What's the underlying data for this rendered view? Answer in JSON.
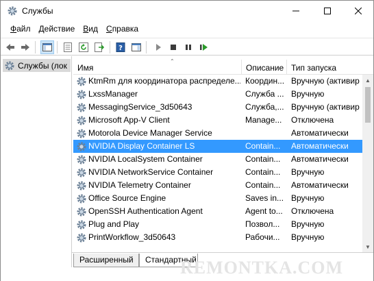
{
  "window": {
    "title": "Службы",
    "icon": "gear-icon",
    "controls": [
      "minimize-icon",
      "maximize-icon",
      "close-icon"
    ]
  },
  "menu": {
    "items": [
      {
        "underline": "Ф",
        "rest": "айл"
      },
      {
        "underline": "Д",
        "rest": "ействие"
      },
      {
        "underline": "В",
        "rest": "ид"
      },
      {
        "underline": "С",
        "rest": "правка"
      }
    ]
  },
  "toolbar": {
    "buttons": [
      "back-arrow-icon",
      "forward-arrow-icon",
      "console-tree-icon",
      "properties-icon",
      "refresh-icon",
      "export-list-icon",
      "help-icon",
      "show-hide-pane-icon",
      "start-service-icon",
      "stop-service-icon",
      "pause-service-icon",
      "restart-service-icon"
    ]
  },
  "tree": {
    "selected_label": "Службы (лок"
  },
  "columns": {
    "name": "Имя",
    "description": "Описание",
    "startup": "Тип запуска"
  },
  "services": [
    {
      "name": "KtmRm для координатора распределе...",
      "description": "Координ...",
      "startup": "Вручную (активир"
    },
    {
      "name": "LxssManager",
      "description": "Служба ...",
      "startup": "Вручную"
    },
    {
      "name": "MessagingService_3d50643",
      "description": "Служба,...",
      "startup": "Вручную (активир"
    },
    {
      "name": "Microsoft App-V Client",
      "description": "Manage...",
      "startup": "Отключена"
    },
    {
      "name": "Motorola Device Manager Service",
      "description": "",
      "startup": "Автоматически"
    },
    {
      "name": "NVIDIA Display Container LS",
      "description": "Contain...",
      "startup": "Автоматически",
      "selected": true
    },
    {
      "name": "NVIDIA LocalSystem Container",
      "description": "Contain...",
      "startup": "Автоматически"
    },
    {
      "name": "NVIDIA NetworkService Container",
      "description": "Contain...",
      "startup": "Вручную"
    },
    {
      "name": "NVIDIA Telemetry Container",
      "description": "Contain...",
      "startup": "Автоматически"
    },
    {
      "name": "Office  Source Engine",
      "description": "Saves in...",
      "startup": "Вручную"
    },
    {
      "name": "OpenSSH Authentication Agent",
      "description": "Agent to...",
      "startup": "Отключена"
    },
    {
      "name": "Plug and Play",
      "description": "Позвол...",
      "startup": "Вручную"
    },
    {
      "name": "PrintWorkflow_3d50643",
      "description": "Рабочи...",
      "startup": "Вручную"
    }
  ],
  "tabs": {
    "extended": "Расширенный",
    "standard": "Стандартный",
    "active": "standard"
  },
  "watermark": "REMONTKA.COM",
  "colors": {
    "selection": "#3399ff",
    "tree_selection": "#d9d9d9"
  }
}
